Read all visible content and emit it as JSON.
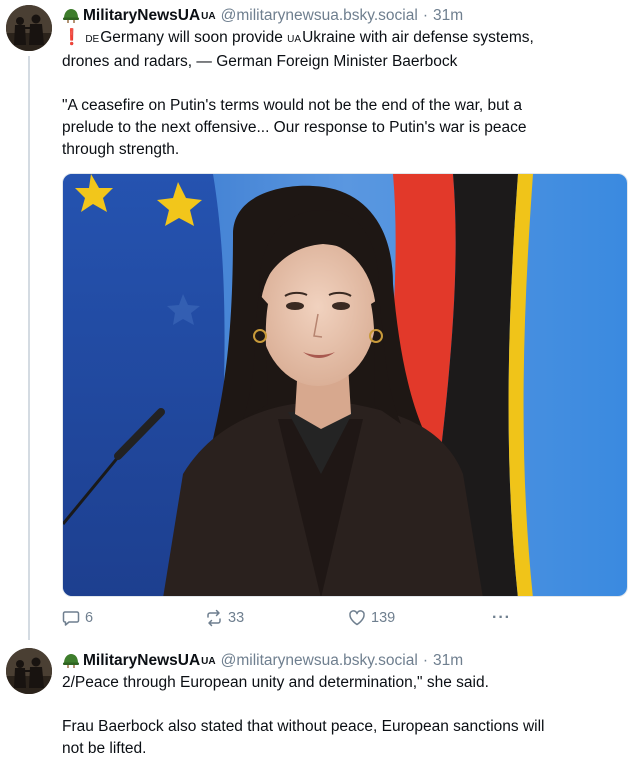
{
  "posts": [
    {
      "author": {
        "display_name": "MilitaryNewsUA",
        "flag_code": "UA",
        "handle": "@militarynewsua.bsky.social",
        "time": "31m",
        "avatar_icon": "soldiers-silhouette-avatar",
        "badge_icon": "green-helmet-icon"
      },
      "text": {
        "exclamation": "❗",
        "line1_code_de": "DE",
        "line1_part1": "Germany will soon provide ",
        "line1_code_ua": "UA",
        "line1_part2": "Ukraine with air defense systems,",
        "line2": "drones and radars, — German Foreign Minister Baerbock",
        "quote_line1": "\"A ceasefire on Putin's terms would not be the end of the war, but a",
        "quote_line2": "prelude to the next offensive... Our response to Putin's war is peace",
        "quote_line3": "through strength."
      },
      "image": {
        "description_icon": "photo-baerbock-at-podium"
      },
      "actions": {
        "replies": "6",
        "reposts": "33",
        "likes": "139",
        "more_label": "···"
      }
    },
    {
      "author": {
        "display_name": "MilitaryNewsUA",
        "flag_code": "UA",
        "handle": "@militarynewsua.bsky.social",
        "time": "31m",
        "avatar_icon": "soldiers-silhouette-avatar",
        "badge_icon": "green-helmet-icon"
      },
      "text": {
        "line1": "2/Peace through European unity and determination,\" she said.",
        "line2": "Frau Baerbock also stated that without peace, European sanctions will",
        "line3": "not be lifted."
      }
    }
  ],
  "colors": {
    "text": "#0b0f14",
    "muted": "#6f7f8f",
    "thread_line": "#d4dbe2",
    "exclamation": "#e5222b",
    "eu_blue": "#1f4fa8",
    "eu_star": "#f2c61b"
  }
}
